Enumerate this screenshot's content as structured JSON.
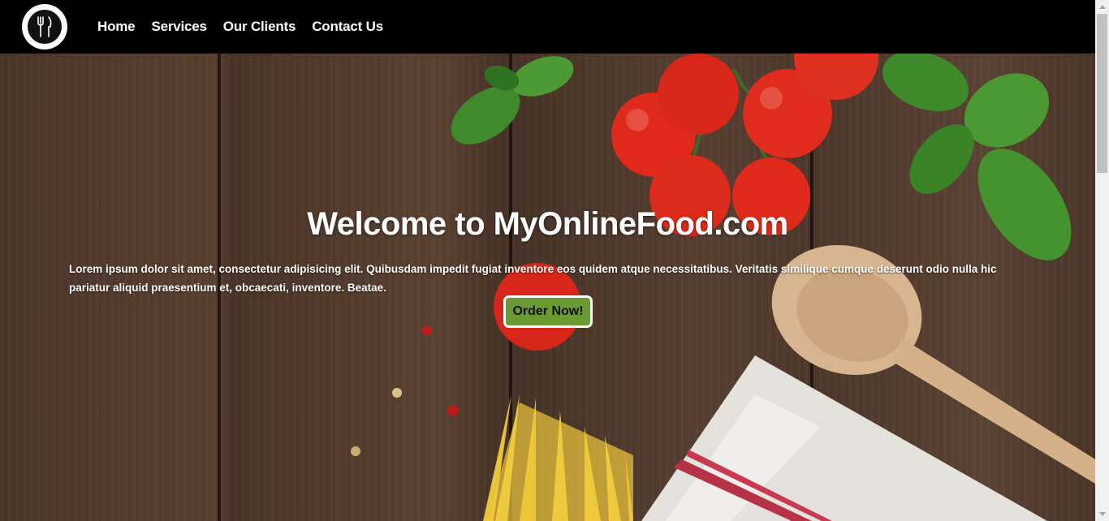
{
  "site": {
    "logo_icon": "fork-knife-logo-icon"
  },
  "nav": {
    "items": [
      {
        "label": "Home"
      },
      {
        "label": "Services"
      },
      {
        "label": "Our Clients"
      },
      {
        "label": "Contact Us"
      }
    ]
  },
  "hero": {
    "title": "Welcome to MyOnlineFood.com",
    "text": "Lorem ipsum dolor sit amet, consectetur adipisicing elit. Quibusdam impedit fugiat inventore eos quidem atque necessitatibus. Veritatis similique cumque deserunt odio nulla hic pariatur aliquid praesentium et, obcaecati, inventore. Beatae.",
    "button_label": "Order Now!"
  },
  "colors": {
    "navbar_bg": "#000000",
    "button_bg": "#6a9a32",
    "hero_wood": "#4b3529"
  }
}
